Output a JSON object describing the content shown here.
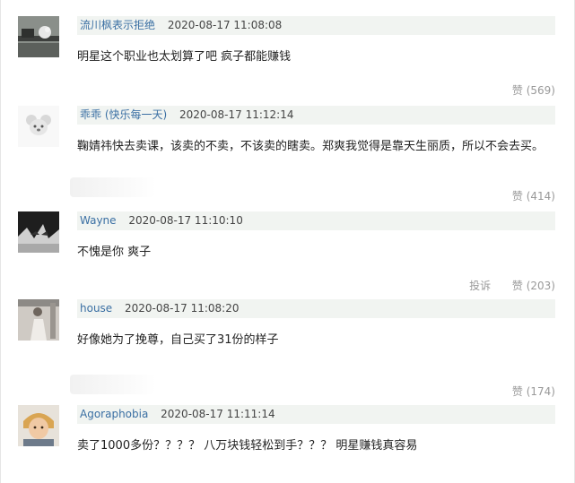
{
  "comments": [
    {
      "username": "流川枫表示拒绝",
      "timestamp": "2020-08-17 11:08:08",
      "content": "明星这个职业也太划算了吧 疯子都能赚钱",
      "like_label": "赞 (569)",
      "avatar": "avatar-bird-image"
    },
    {
      "username": "乖乖 (快乐每一天)",
      "timestamp": "2020-08-17 11:12:14",
      "content": "鞠婧祎快去卖课，该卖的不卖，不该卖的瞎卖。郑爽我觉得是靠天生丽质，所以不会去买。",
      "like_label": "赞 (414)",
      "avatar": "avatar-koala-image"
    },
    {
      "username": "Wayne",
      "timestamp": "2020-08-17 11:10:10",
      "content": "不愧是你 爽子",
      "report_label": "投诉",
      "like_label": "赞 (203)",
      "avatar": "avatar-anime-image"
    },
    {
      "username": "house",
      "timestamp": "2020-08-17 11:08:20",
      "content": "好像她为了挽尊，自己买了31份的样子",
      "like_label": "赞 (174)",
      "avatar": "avatar-person-image"
    },
    {
      "username": "Agoraphobia",
      "timestamp": "2020-08-17 11:11:14",
      "content": "卖了1000多份？？？？ 八万块钱轻松到手？？？ 明星赚钱真容易",
      "avatar": "avatar-child-image"
    }
  ]
}
